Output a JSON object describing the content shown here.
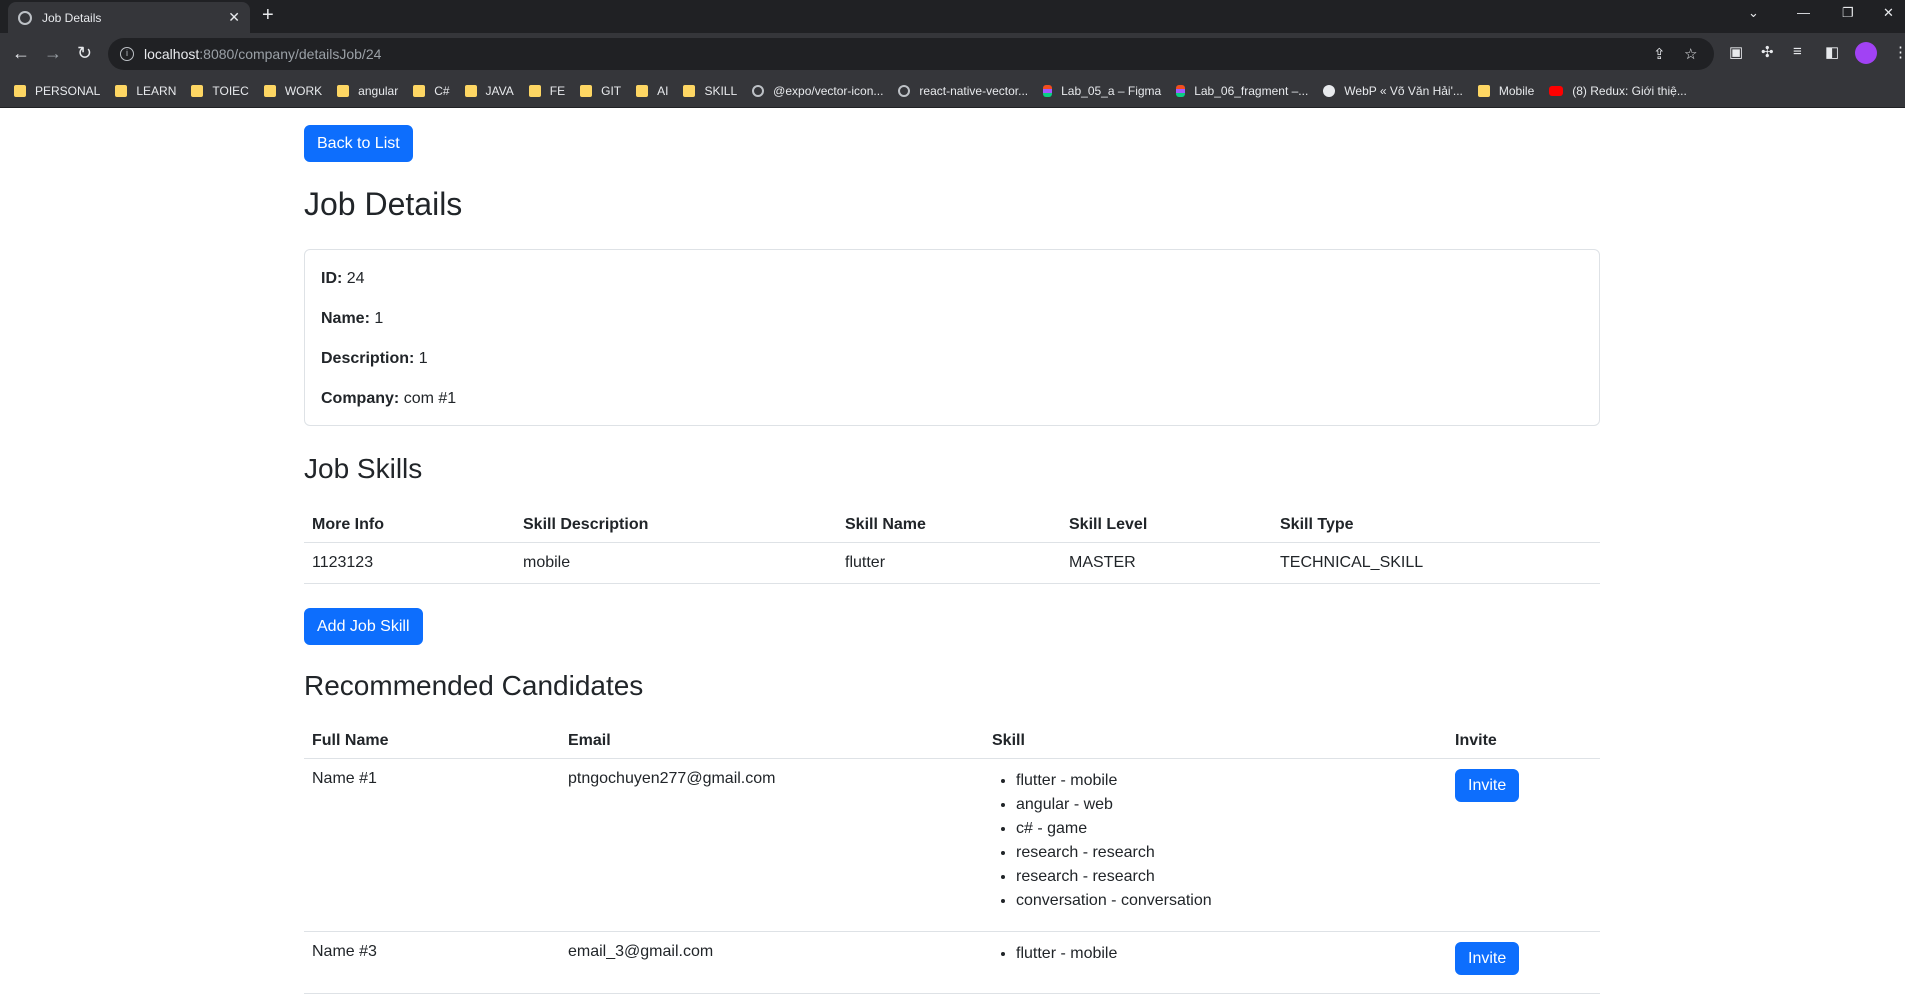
{
  "browser": {
    "tab_title": "Job Details",
    "url_host": "localhost",
    "url_path": ":8080/company/detailsJob/24",
    "bookmarks": [
      {
        "label": "PERSONAL",
        "icon": "folder"
      },
      {
        "label": "LEARN",
        "icon": "folder"
      },
      {
        "label": "TOIEC",
        "icon": "folder"
      },
      {
        "label": "WORK",
        "icon": "folder"
      },
      {
        "label": "angular",
        "icon": "folder"
      },
      {
        "label": "C#",
        "icon": "folder"
      },
      {
        "label": "JAVA",
        "icon": "folder"
      },
      {
        "label": "FE",
        "icon": "folder"
      },
      {
        "label": "GIT",
        "icon": "folder"
      },
      {
        "label": "AI",
        "icon": "folder"
      },
      {
        "label": "SKILL",
        "icon": "folder"
      },
      {
        "label": "@expo/vector-icon...",
        "icon": "globe"
      },
      {
        "label": "react-native-vector...",
        "icon": "globe"
      },
      {
        "label": "Lab_05_a – Figma",
        "icon": "figma"
      },
      {
        "label": "Lab_06_fragment –...",
        "icon": "figma"
      },
      {
        "label": "WebP « Võ Văn Hải'...",
        "icon": "wp"
      },
      {
        "label": "Mobile",
        "icon": "folder"
      },
      {
        "label": "(8) Redux: Giới thiệ...",
        "icon": "yt"
      }
    ]
  },
  "page": {
    "back_label": "Back to List",
    "title": "Job Details",
    "details": {
      "id_label": "ID:",
      "id_value": "24",
      "name_label": "Name:",
      "name_value": "1",
      "desc_label": "Description:",
      "desc_value": "1",
      "company_label": "Company:",
      "company_value": "com #1"
    },
    "skills_title": "Job Skills",
    "skills_headers": [
      "More Info",
      "Skill Description",
      "Skill Name",
      "Skill Level",
      "Skill Type"
    ],
    "skills_rows": [
      [
        "1123123",
        "mobile",
        "flutter",
        "MASTER",
        "TECHNICAL_SKILL"
      ]
    ],
    "add_skill_label": "Add Job Skill",
    "candidates_title": "Recommended Candidates",
    "candidates_headers": [
      "Full Name",
      "Email",
      "Skill",
      "Invite"
    ],
    "candidates": [
      {
        "name": "Name #1",
        "email": "ptngochuyen277@gmail.com",
        "skills": [
          "flutter - mobile",
          "angular - web",
          "c# - game",
          "research - research",
          "research - research",
          "conversation - conversation"
        ],
        "invite_label": "Invite"
      },
      {
        "name": "Name #3",
        "email": "email_3@gmail.com",
        "skills": [
          "flutter - mobile"
        ],
        "invite_label": "Invite"
      }
    ]
  }
}
